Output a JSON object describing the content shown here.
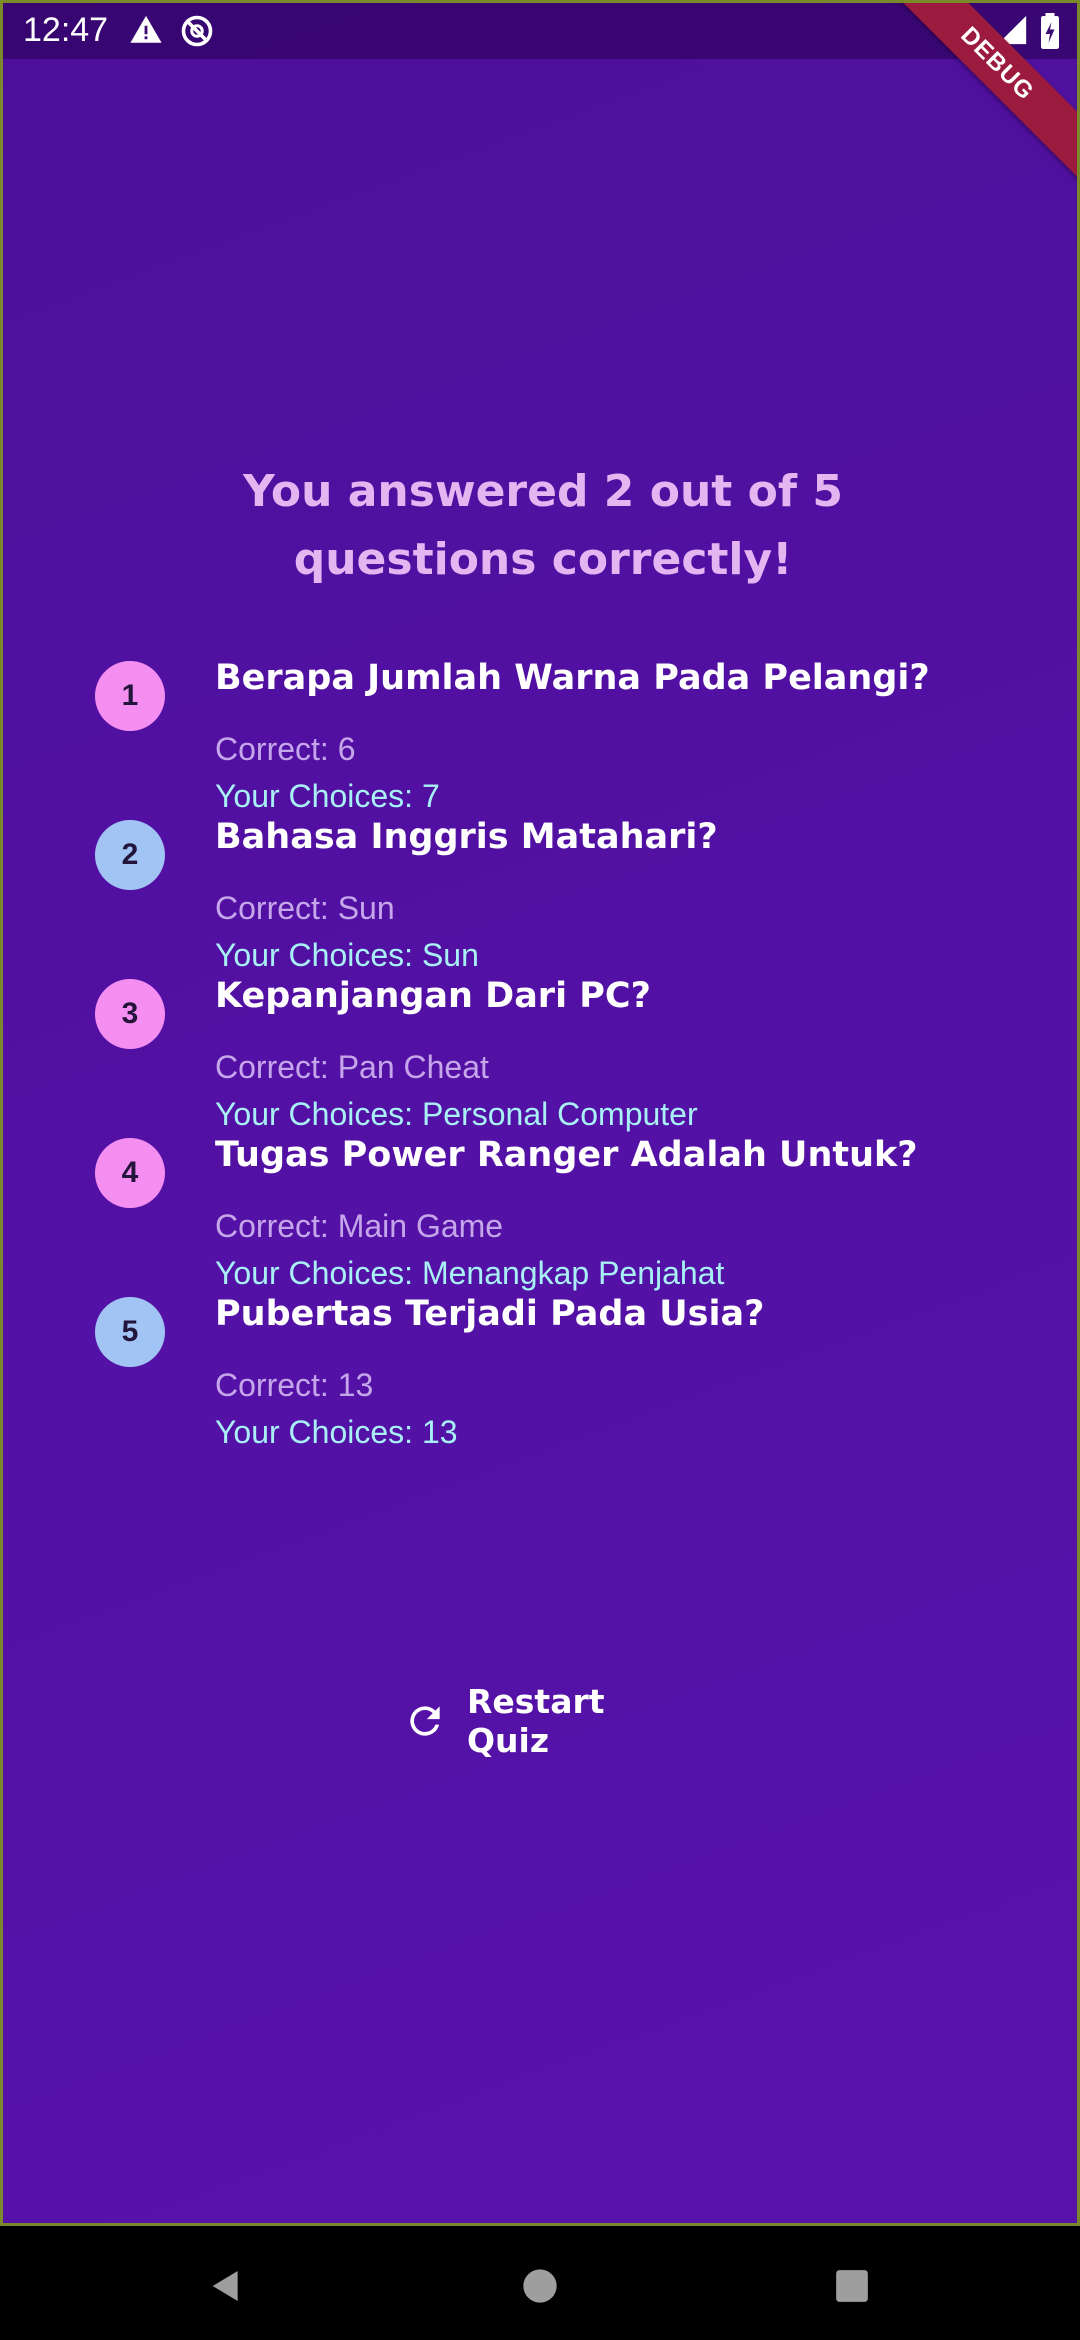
{
  "status_bar": {
    "time": "12:47",
    "left_icons": [
      "warning-icon",
      "no-sync-icon"
    ],
    "right_icons": [
      "wifi-icon",
      "signal-icon",
      "battery-icon"
    ]
  },
  "debug_banner": "DEBUG",
  "results": {
    "title": "You answered 2 out of 5 questions correctly!",
    "items": [
      {
        "number": "1",
        "question": "Berapa Jumlah Warna Pada Pelangi?",
        "correct": "Correct: 6",
        "choice": "Your Choices: 7",
        "is_correct": false
      },
      {
        "number": "2",
        "question": "Bahasa Inggris Matahari?",
        "correct": "Correct: Sun",
        "choice": "Your Choices: Sun",
        "is_correct": true
      },
      {
        "number": "3",
        "question": "Kepanjangan Dari PC?",
        "correct": "Correct: Pan Cheat",
        "choice": "Your Choices: Personal Computer",
        "is_correct": false
      },
      {
        "number": "4",
        "question": "Tugas Power Ranger Adalah Untuk?",
        "correct": "Correct: Main Game",
        "choice": "Your Choices: Menangkap Penjahat",
        "is_correct": false
      },
      {
        "number": "5",
        "question": "Pubertas Terjadi Pada Usia?",
        "correct": "Correct: 13",
        "choice": "Your Choices: 13",
        "is_correct": true
      }
    ]
  },
  "restart_button": {
    "label": "Restart Quiz",
    "icon": "refresh-icon"
  },
  "colors": {
    "background": "#5311a5",
    "title": "#e3b6f2",
    "wrong_badge": "#f48ef0",
    "right_badge": "#a2c4f5",
    "correct_text": "#c6a6ea",
    "choice_text": "#a9f0f6"
  },
  "nav_bar": {
    "buttons": [
      "back-icon",
      "home-icon",
      "recents-icon"
    ]
  }
}
